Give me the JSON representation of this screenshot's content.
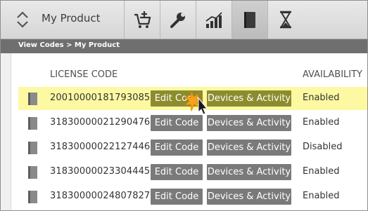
{
  "product": {
    "name": "My Product"
  },
  "toolbar": {
    "tools": [
      {
        "icon": "cart-add-icon"
      },
      {
        "icon": "wrench-icon"
      },
      {
        "icon": "bar-chart-icon"
      },
      {
        "icon": "book-icon",
        "active": true
      },
      {
        "icon": "hourglass-icon"
      }
    ]
  },
  "breadcrumb": "View Codes > My Product",
  "table": {
    "headers": {
      "code": "LICENSE CODE",
      "availability": "AVAILABILITY"
    },
    "rows": [
      {
        "code": "200100001817930859",
        "edit": "Edit Code",
        "devices": "Devices & Activity",
        "availability": "Enabled",
        "highlighted": true
      },
      {
        "code": "318300000212904761",
        "edit": "Edit Code",
        "devices": "Devices & Activity",
        "availability": "Enabled"
      },
      {
        "code": "318300000221274462",
        "edit": "Edit Code",
        "devices": "Devices & Activity",
        "availability": "Disabled"
      },
      {
        "code": "318300000233044459",
        "edit": "Edit Code",
        "devices": "Devices & Activity",
        "availability": "Enabled"
      },
      {
        "code": "318300000248078275",
        "edit": "Edit Code",
        "devices": "Devices & Activity",
        "availability": "Enabled"
      }
    ]
  },
  "colors": {
    "highlight": "#fcf9a2",
    "highlight_button": "#8c8c2f",
    "button": "#7a7a7a",
    "breadcrumb_bar": "#6f6f6f"
  }
}
